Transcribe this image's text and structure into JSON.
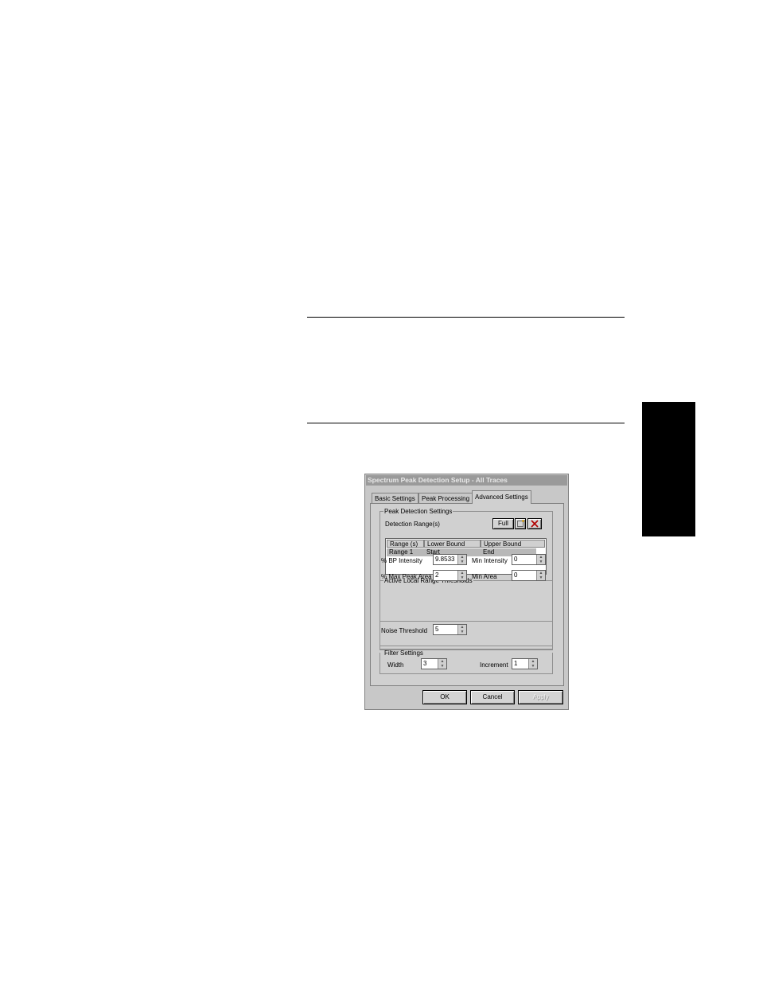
{
  "dialog": {
    "title": "Spectrum Peak Detection Setup - All Traces",
    "tabs": [
      "Basic Settings",
      "Peak Processing",
      "Advanced Settings"
    ],
    "peak_detection": {
      "group_label": "Peak Detection Settings",
      "detection_range_label": "Detection Range(s)",
      "full_button": "Full",
      "table_headers": [
        "Range (s)",
        "Lower Bound",
        "Upper Bound"
      ],
      "rows": [
        {
          "range": "Range 1",
          "lower": "Start",
          "upper": "End"
        }
      ]
    },
    "thresholds": {
      "group_label": "Active Local Range Thresholds",
      "bp_intensity_label": "% BP Intensity",
      "bp_intensity_value": "9.8533",
      "min_intensity_label": "Min Intensity",
      "min_intensity_value": "0",
      "max_peak_area_label": "% Max Peak Area",
      "max_peak_area_value": "2",
      "min_area_label": "Min Area",
      "min_area_value": "0"
    },
    "noise": {
      "label": "Noise Threshold",
      "value": "5"
    },
    "filter": {
      "group_label": "Filter Settings",
      "width_label": "Width",
      "width_value": "3",
      "increment_label": "Increment",
      "increment_value": "1"
    },
    "buttons": {
      "ok": "OK",
      "cancel": "Cancel",
      "apply": "Apply"
    }
  }
}
